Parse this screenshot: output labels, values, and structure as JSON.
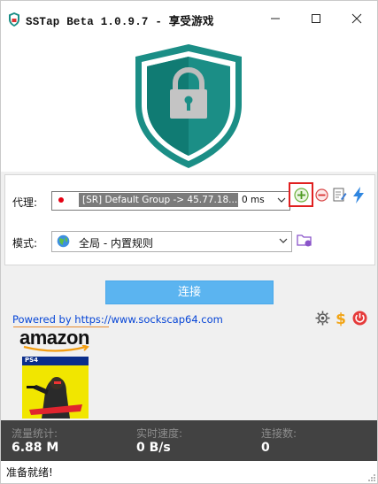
{
  "window": {
    "title_latin": "SSTap Beta 1.0.9.7 - ",
    "title_cjk": "享受游戏"
  },
  "proxy": {
    "label": "代理:",
    "selected_name": "[SR] Default Group -> 45.77.18...",
    "latency": "0 ms"
  },
  "mode": {
    "label": "模式:",
    "selected": "全局 - 内置规则"
  },
  "connect_label": "连接",
  "powered_by": "Powered by https://www.sockscap64.com",
  "ad": {
    "brand": "amazon",
    "platform": "PS4"
  },
  "stats": {
    "traffic_label": "流量统计:",
    "traffic_value": "6.88 M",
    "speed_label": "实时速度:",
    "speed_value": "0 B/s",
    "connections_label": "连接数:",
    "connections_value": "0"
  },
  "status": "准备就绪!",
  "colors": {
    "shield": "#1b8e86",
    "connect": "#5bb4f0",
    "stats_bg": "#424242",
    "highlight_box": "#e02020"
  }
}
